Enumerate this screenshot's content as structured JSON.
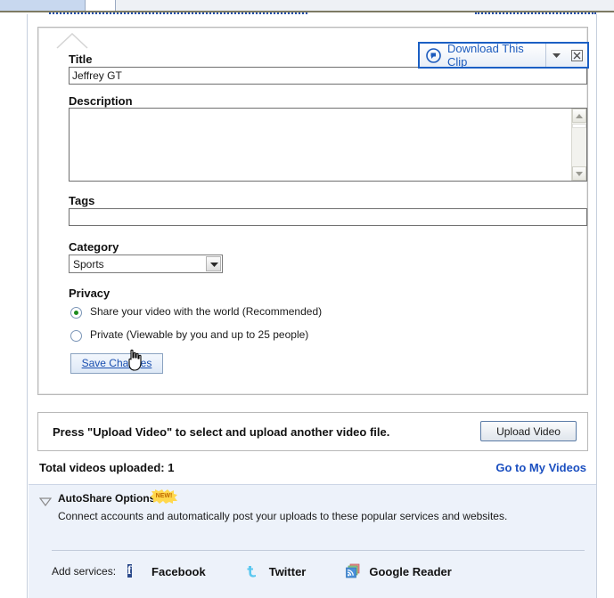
{
  "overlay": {
    "label": "Download This Clip",
    "icon": "speech-bubble-icon",
    "dropdown_icon": "chevron-down-icon",
    "close_icon": "close-icon",
    "border_color": "#1b5fc4",
    "text_color": "#1c5bbd"
  },
  "form": {
    "title": {
      "label": "Title",
      "value": "Jeffrey GT",
      "placeholder": ""
    },
    "description": {
      "label": "Description",
      "value": "",
      "placeholder": ""
    },
    "tags": {
      "label": "Tags",
      "value": "",
      "placeholder": ""
    },
    "category": {
      "label": "Category",
      "selected": "Sports",
      "options": [
        "Sports"
      ]
    },
    "privacy": {
      "label": "Privacy",
      "options": [
        {
          "label": "Share your video with the world (Recommended)",
          "selected": true
        },
        {
          "label": "Private (Viewable by you and up to 25 people)",
          "selected": false
        }
      ]
    },
    "save_button": "Save Changes"
  },
  "upload": {
    "message": "Press \"Upload Video\" to select and upload another video file.",
    "button_label": "Upload Video"
  },
  "totals": {
    "text": "Total videos uploaded: 1",
    "link": "Go to My Videos",
    "link_color": "#1b4fc0"
  },
  "autoshare": {
    "title": "AutoShare Options",
    "badge": "NEW!",
    "badge_color": "#ffd84d",
    "badge_text_color": "#c06a00",
    "description": "Connect accounts and automatically post your uploads to these popular services and websites.",
    "services_lead": "Add services:",
    "services": [
      {
        "name": "Facebook",
        "icon": "facebook-icon",
        "color": "#2b4a8b"
      },
      {
        "name": "Twitter",
        "icon": "twitter-bird-icon",
        "color": "#5bc8f0"
      },
      {
        "name": "Google Reader",
        "icon": "rss-feed-icon",
        "color": "#4a90d9"
      }
    ]
  }
}
